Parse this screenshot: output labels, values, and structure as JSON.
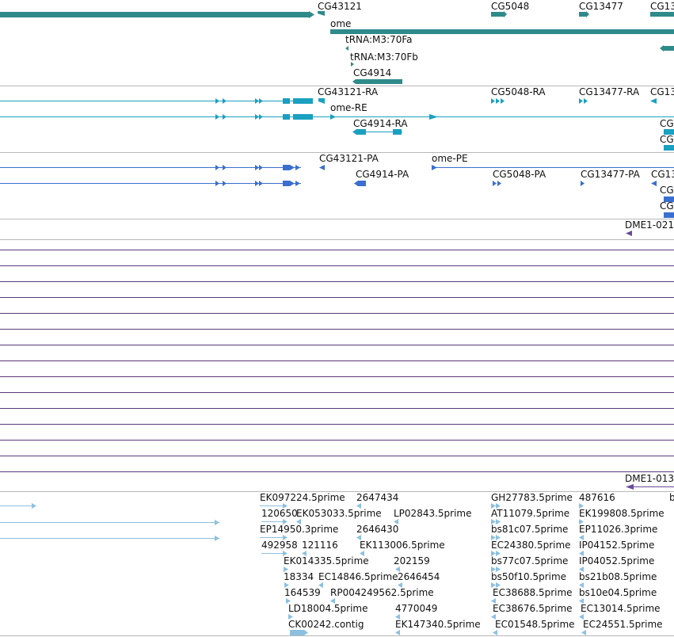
{
  "colors": {
    "gene": "#2f8a8a",
    "transcript": "#1aa0c0",
    "protein": "#3a6fd0",
    "dme": "#6a4a9a",
    "est": "#8cc0e0",
    "separator": "#b8b8b8",
    "empty_track": "#5a3a7a"
  },
  "gene_track": {
    "labels": [
      "CG43121",
      "ome",
      "tRNA:M3:70Fa",
      "tRNA:M3:70Fb",
      "CG4914",
      "CG5048",
      "CG13477",
      "CG13"
    ]
  },
  "transcript_track": {
    "labels": [
      "CG43121-RA",
      "ome-RE",
      "CG4914-RA",
      "CG5048-RA",
      "CG13477-RA",
      "CG13",
      "CG",
      "CG"
    ]
  },
  "protein_track": {
    "labels": [
      "CG43121-PA",
      "ome-PE",
      "CG4914-PA",
      "CG5048-PA",
      "CG13477-PA",
      "CG13",
      "CG",
      "CG"
    ]
  },
  "dme_track_1": {
    "label": "DME1-021"
  },
  "dme_track_2": {
    "label": "DME1-013"
  },
  "est_track": {
    "labels": [
      "EK097224.5prime",
      "2647434",
      "GH27783.5prime",
      "487616",
      "b",
      "120650",
      "EK053033.5prime",
      "LP02843.5prime",
      "AT11079.5prime",
      "EK199808.5prime",
      "EP14950.3prime",
      "2646430",
      "bs81c07.5prime",
      "EP11026.3prime",
      "492958",
      "121116",
      "EK113006.5prime",
      "EC24380.5prime",
      "IP04152.5prime",
      "EK014335.5prime",
      "202159",
      "bs77c07.5prime",
      "IP04052.5prime",
      "18334",
      "EC14846.5prime",
      "2646454",
      "bs50f10.5prime",
      "bs21b08.5prime",
      "164539",
      "RP004249562.5prime",
      "EC38688.5prime",
      "bs10e04.5prime",
      "LD18004.5prime",
      "4770049",
      "EC38676.5prime",
      "EC13014.5prime",
      "CK00242.contig",
      "EK147340.5prime",
      "EC01548.5prime",
      "EC24551.5prime"
    ]
  }
}
